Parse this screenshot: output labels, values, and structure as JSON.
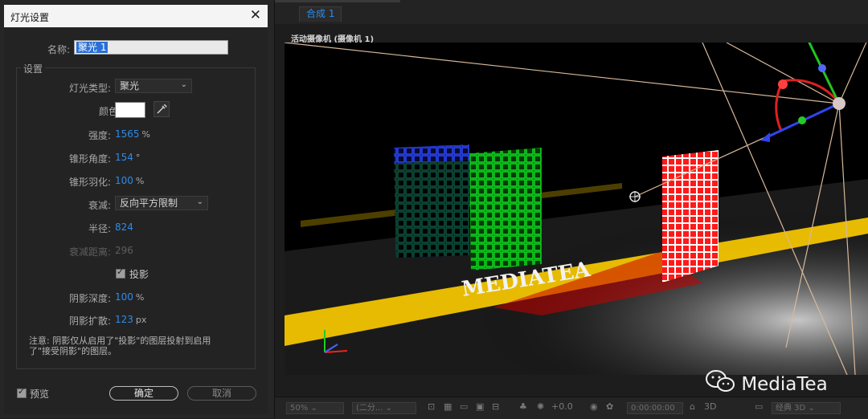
{
  "dialog": {
    "title": "灯光设置",
    "close_icon": "close-icon",
    "name_label": "名称:",
    "name_value": "聚光 1",
    "settings_label": "设置",
    "light_type_label": "灯光类型:",
    "light_type_value": "聚光",
    "color_label": "颜色:",
    "color_value": "#ffffff",
    "eyedropper_icon": "eyedropper-icon",
    "intensity_label": "强度:",
    "intensity_value": "1565",
    "intensity_unit": "%",
    "cone_angle_label": "锥形角度:",
    "cone_angle_value": "154",
    "cone_angle_unit": "°",
    "cone_feather_label": "锥形羽化:",
    "cone_feather_value": "100",
    "cone_feather_unit": "%",
    "falloff_label": "衰减:",
    "falloff_value": "反向平方限制",
    "radius_label": "半径:",
    "radius_value": "824",
    "falloff_distance_label": "衰减距离:",
    "falloff_distance_value": "296",
    "cast_shadows_label": "投影",
    "shadow_darkness_label": "阴影深度:",
    "shadow_darkness_value": "100",
    "shadow_darkness_unit": "%",
    "shadow_diffusion_label": "阴影扩散:",
    "shadow_diffusion_value": "123",
    "shadow_diffusion_unit": "px",
    "note_line1": "注意: 阴影仅从启用了\"投影\"的图层投射到启用",
    "note_line2": "了\"接受阴影\"的图层。",
    "preview_label": "预览",
    "ok_label": "确定",
    "cancel_label": "取消"
  },
  "composition": {
    "tab_label": "合成 1",
    "view_label": "活动摄像机 (摄像机 1)",
    "scene_text": "MEDIATEA",
    "colors": {
      "blue_grid": "#2a47ff",
      "green_grid": "#11dd22",
      "red_grid": "#ff1a1a",
      "road_stripe": "#f2c400"
    }
  },
  "viewer_bar": {
    "zoom": "50%",
    "resolution": "(二分...",
    "exposure": "+0.0",
    "timecode": "0:00:00:00",
    "renderer": "经典 3D",
    "renderer_prefix": "3D"
  },
  "watermark": "MediaTea"
}
